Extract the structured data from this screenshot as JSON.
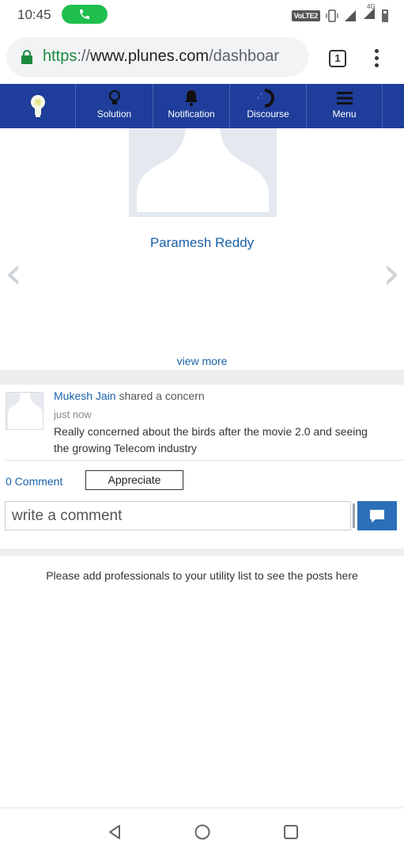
{
  "status_bar": {
    "time": "10:45",
    "volte": "VoLTE2",
    "network": "4G"
  },
  "browser": {
    "url_scheme": "https",
    "url_sep": "://",
    "url_host": "www.plunes.com",
    "url_path": "/dashboar",
    "tab_count": "1"
  },
  "nav": {
    "items": [
      {
        "label": "Solution",
        "icon": "lightbulb-icon"
      },
      {
        "label": "Notification",
        "icon": "bell-icon"
      },
      {
        "label": "Discourse",
        "icon": "discourse-icon"
      },
      {
        "label": "Menu",
        "icon": "hamburger-icon"
      }
    ]
  },
  "profile": {
    "name": "Paramesh Reddy",
    "view_more": "view more"
  },
  "post": {
    "author": "Mukesh Jain",
    "action": " shared a concern",
    "time": "just now",
    "body": "Really concerned about the birds after the movie 2.0 and seeing the growing Telecom industry",
    "comment_count": "0 Comment",
    "appreciate_label": "Appreciate",
    "comment_placeholder": "write a comment"
  },
  "empty_message": "Please add professionals to your utility list to see the posts here",
  "colors": {
    "nav_blue": "#1f3d9a",
    "link_blue": "#1a61a8",
    "call_green": "#1fbf4e"
  }
}
